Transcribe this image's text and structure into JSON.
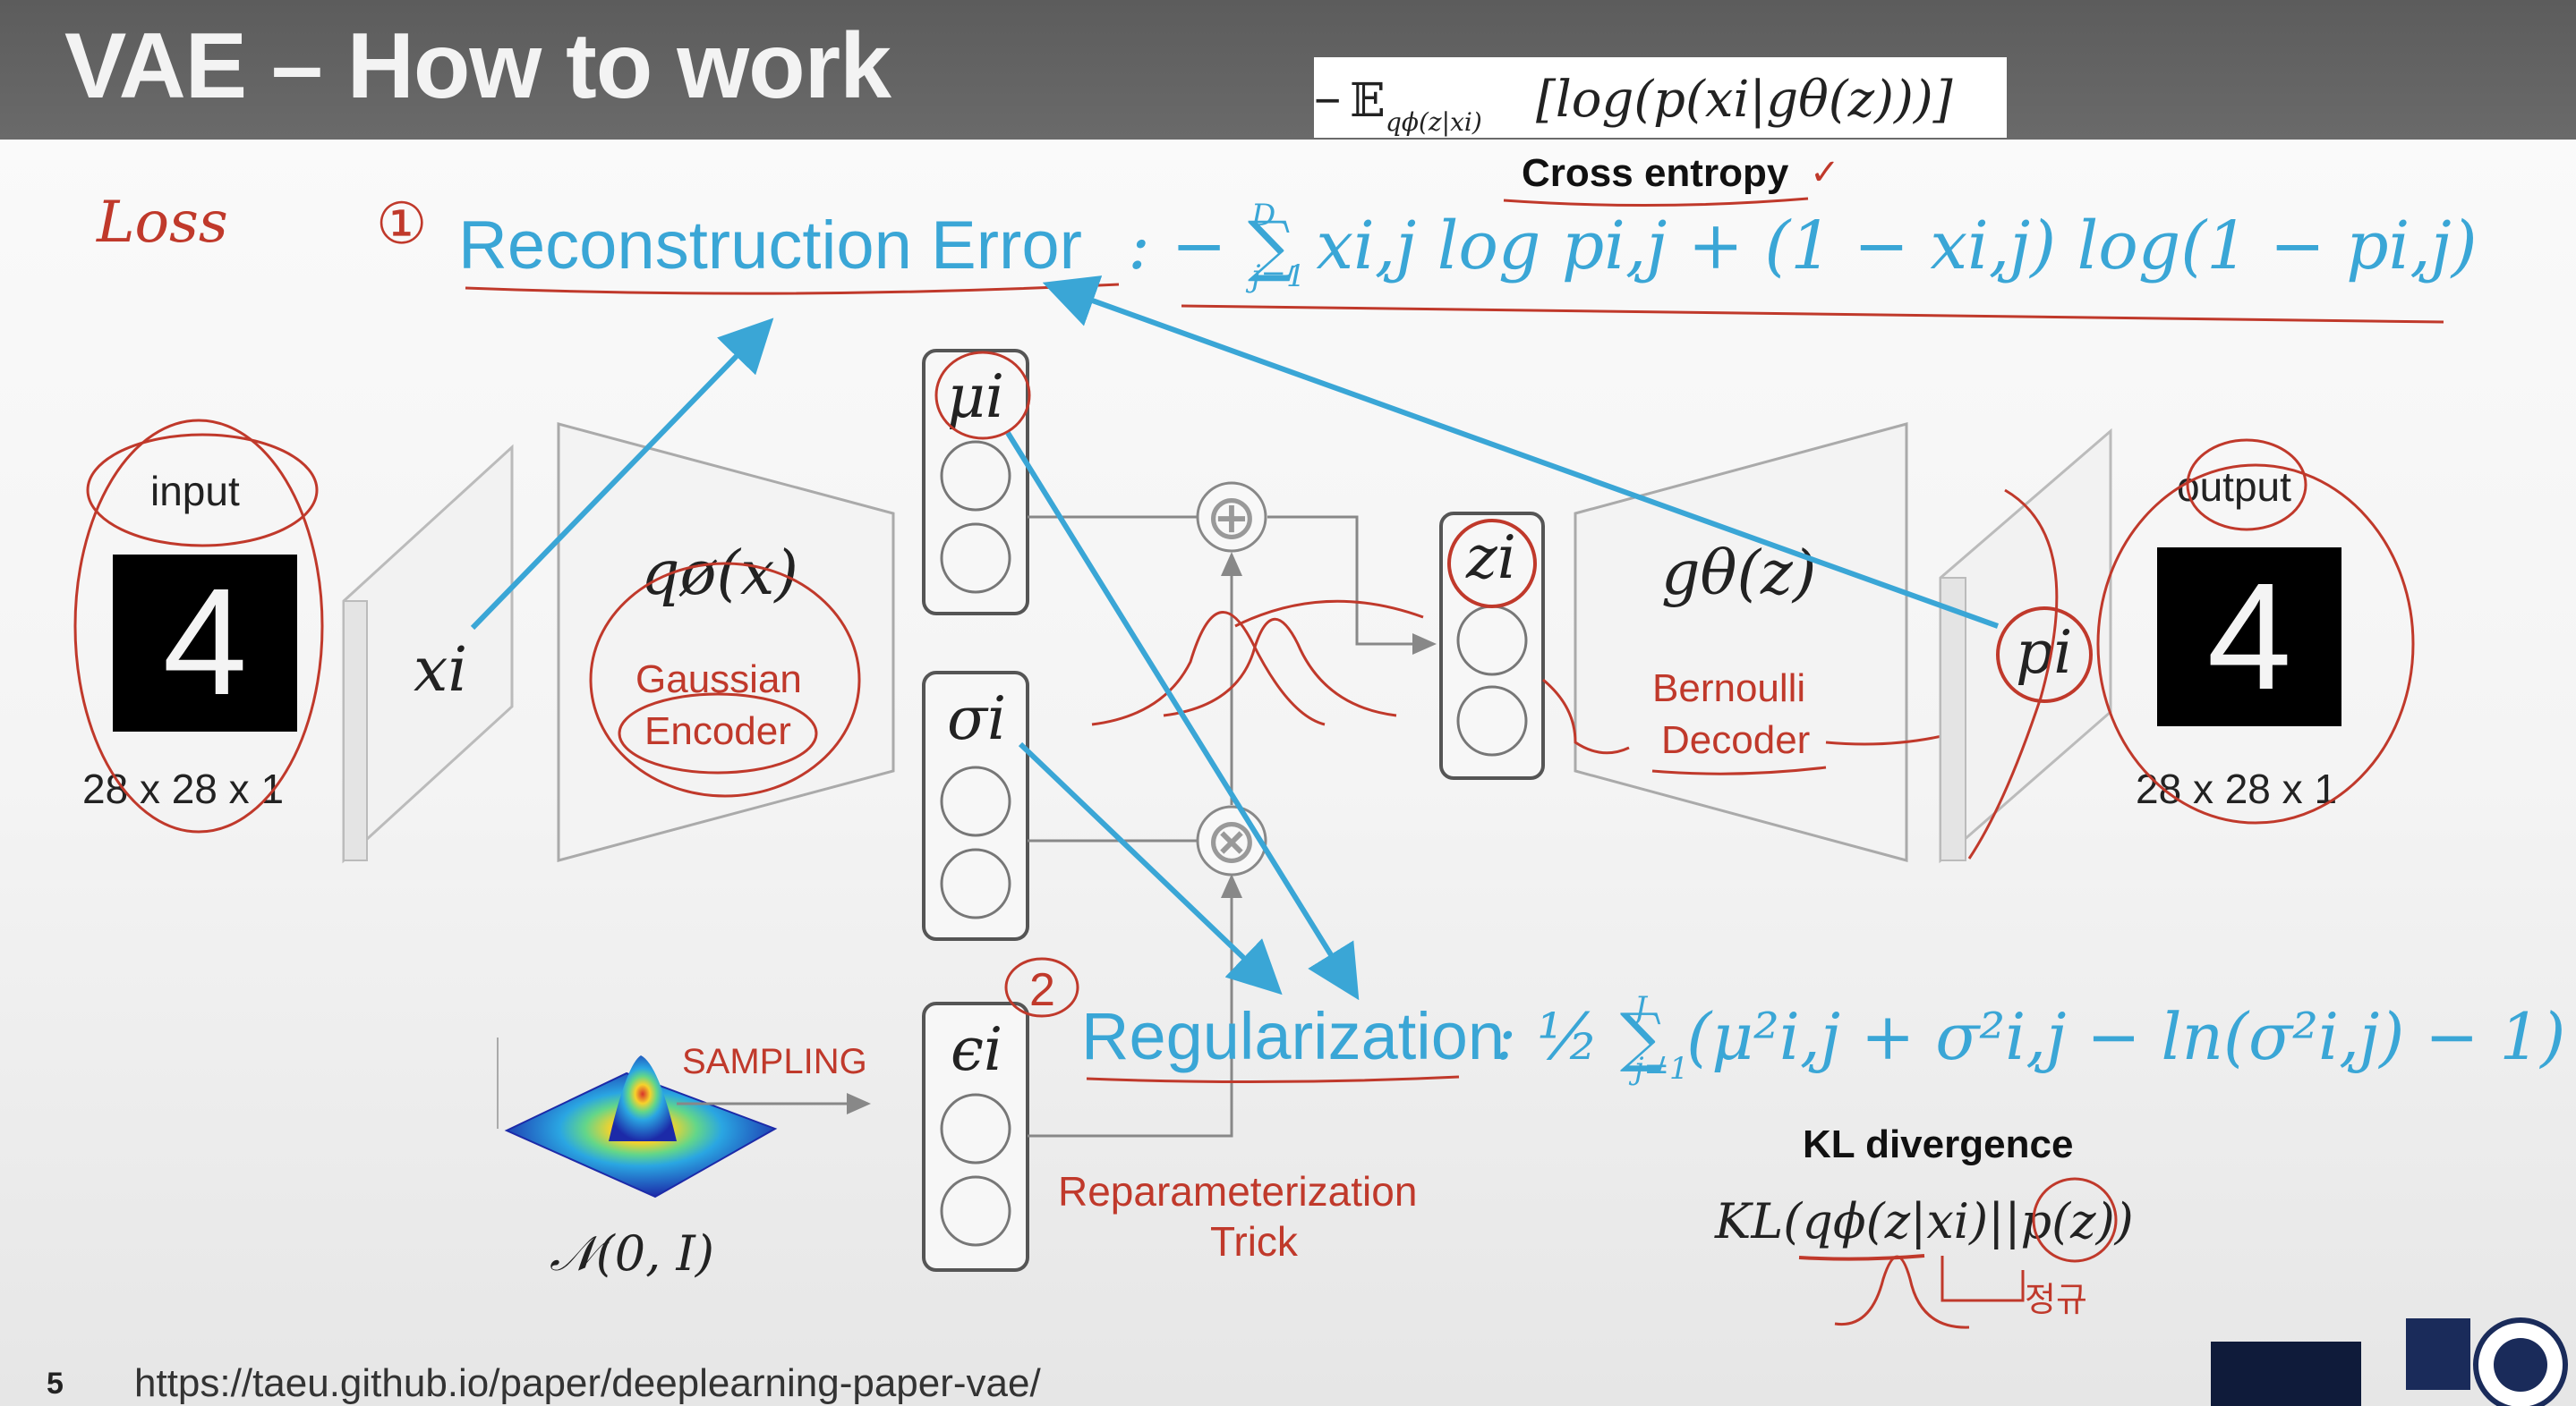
{
  "slide": {
    "title": "VAE – How to work",
    "number": "5",
    "url": "https://taeu.github.io/paper/deeplearning-paper-vae/"
  },
  "annotations": {
    "loss": "Loss",
    "num1": "①",
    "num2": "2",
    "check": "✓"
  },
  "expectation": {
    "minus": "−",
    "E": "𝔼",
    "sub": "qϕ(z|xi)",
    "body": "[log(p(xi|gθ(z)))]"
  },
  "cross_entropy": "Cross entropy",
  "reconstruction": {
    "label": "Reconstruction Error",
    "formula": ": − ∑ xi,j log pi,j + (1 − xi,j) log(1 − pi,j)",
    "sum_upper": "D",
    "sum_lower": "j=1"
  },
  "regularization": {
    "label": "Regularization",
    "formula": ": ½ ∑ (μ²i,j + σ²i,j − ln(σ²i,j) − 1)",
    "sum_upper": "J",
    "sum_lower": "j=1"
  },
  "input": {
    "label": "input",
    "size": "28 x 28 x 1",
    "digit": "4"
  },
  "output": {
    "label": "output",
    "size": "28 x 28 x 1",
    "digit": "4"
  },
  "encoder": {
    "var": "xi",
    "func": "qø(x)",
    "name_line1": "Gaussian",
    "name_line2": "Encoder"
  },
  "latent": {
    "mu": "μi",
    "sigma": "σi",
    "epsilon": "ϵi",
    "z": "zi",
    "plus": "⊕",
    "times": "⊗"
  },
  "decoder": {
    "func": "gθ(z)",
    "name_line1": "Bernoulli",
    "name_line2": "Decoder",
    "out": "pi"
  },
  "sampling": {
    "label": "SAMPLING",
    "dist": "𝒩(0, I)"
  },
  "reparam": {
    "line1": "Reparameterization",
    "line2": "Trick"
  },
  "kl": {
    "title": "KL divergence",
    "formula": "KL(qϕ(z|xi)||p(z))",
    "note": "정규"
  },
  "colors": {
    "blue": "#3aa6d6",
    "red": "#c0392b",
    "title_bg": "#626262"
  }
}
